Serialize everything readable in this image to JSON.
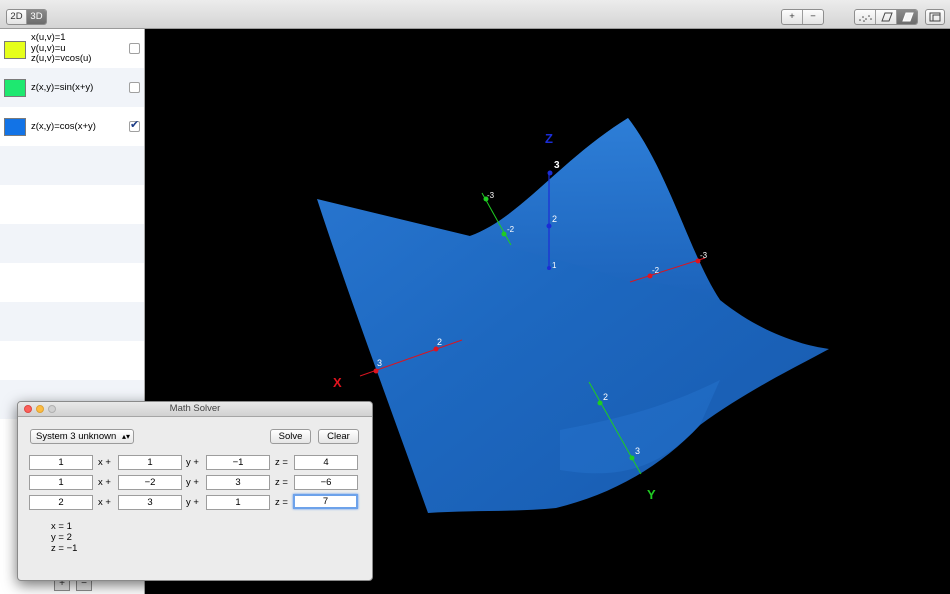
{
  "toolbar": {
    "mode_2d": "2D",
    "mode_3d": "3D",
    "zoom_in": "+",
    "zoom_out": "−"
  },
  "sidebar": {
    "functions": [
      {
        "lines": "x(u,v)=1\ny(u,v)=u\nz(u,v)=vcos(u)",
        "color": "#e6ff1a",
        "checked": false
      },
      {
        "lines": "z(x,y)=sin(x+y)",
        "color": "#1ee870",
        "checked": false
      },
      {
        "lines": "z(x,y)=cos(x+y)",
        "color": "#1273e6",
        "checked": true
      }
    ],
    "add_label": "+",
    "remove_label": "−"
  },
  "plot": {
    "surface_color": "#1f6fc8",
    "axes": {
      "x": {
        "label": "X",
        "ticks": [
          "3",
          "2",
          "-2",
          "-3"
        ],
        "color": "#e0141e"
      },
      "y": {
        "label": "Y",
        "ticks": [
          "2",
          "3",
          "-2",
          "-3"
        ],
        "color": "#1fcc22"
      },
      "z": {
        "label": "Z",
        "ticks": [
          "1",
          "2",
          "3"
        ],
        "color": "#1a2dd6"
      }
    }
  },
  "dialog": {
    "title": "Math Solver",
    "mode_select": "System 3 unknown",
    "solve_label": "Solve",
    "clear_label": "Clear",
    "equations": [
      {
        "a": "1",
        "b": "1",
        "c": "−1",
        "d": "4"
      },
      {
        "a": "1",
        "b": "−2",
        "c": "3",
        "d": "−6"
      },
      {
        "a": "2",
        "b": "3",
        "c": "1",
        "d": "7"
      }
    ],
    "ops": {
      "x": "x +",
      "y": "y +",
      "z": "z ="
    },
    "results": [
      "x = 1",
      "y = 2",
      "z = −1"
    ]
  }
}
